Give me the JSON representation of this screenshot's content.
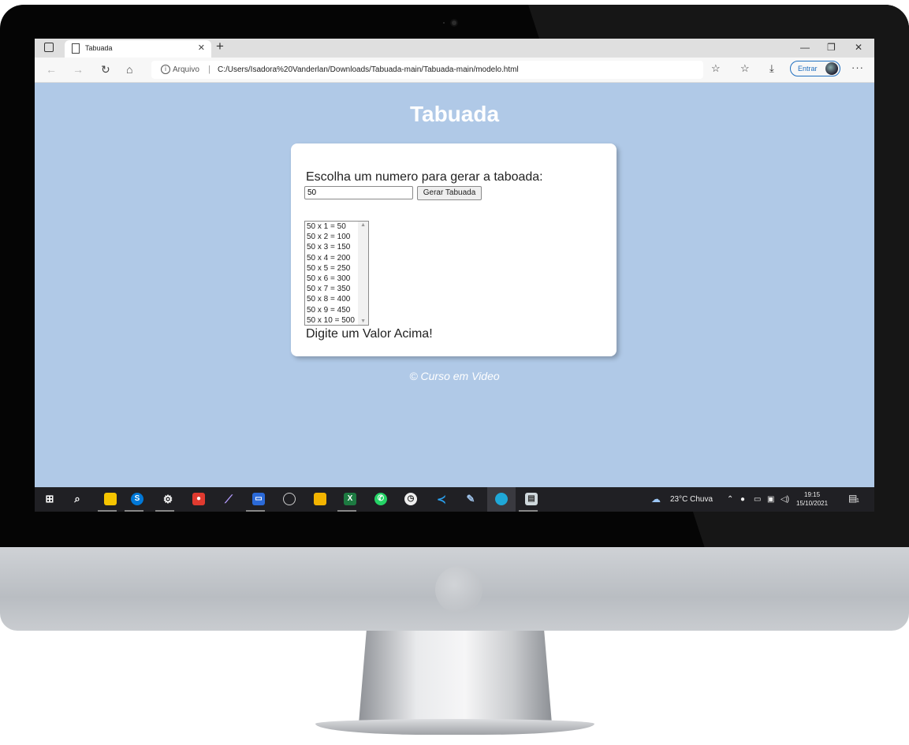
{
  "browser": {
    "tab_title": "Tabuada",
    "address_scheme": "Arquivo",
    "address_url": "C:/Users/Isadora%20Vanderlan/Downloads/Tabuada-main/Tabuada-main/modelo.html",
    "signin_label": "Entrar"
  },
  "page": {
    "title": "Tabuada",
    "prompt": "Escolha um numero para gerar a taboada:",
    "input_value": "50",
    "button_label": "Gerar Tabuada",
    "results": [
      "50 x 1 = 50",
      "50 x 2 = 100",
      "50 x 3 = 150",
      "50 x 4 = 200",
      "50 x 5 = 250",
      "50 x 6 = 300",
      "50 x 7 = 350",
      "50 x 8 = 400",
      "50 x 9 = 450",
      "50 x 10 = 500"
    ],
    "message": "Digite um Valor Acima!",
    "footer": "© Curso em Video"
  },
  "taskbar": {
    "weather": "23°C  Chuva",
    "time": "19:15",
    "date": "15/10/2021",
    "notification_count": "1"
  },
  "colors": {
    "page_background": "#b0c9e7",
    "accent": "#1f6fbf"
  }
}
